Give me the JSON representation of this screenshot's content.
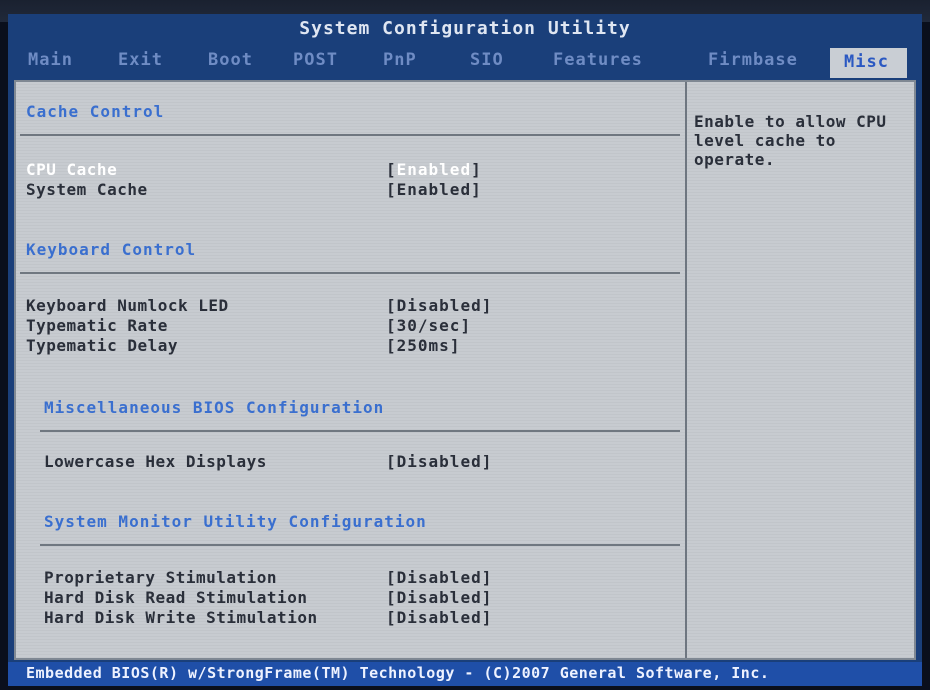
{
  "title": "System Configuration Utility",
  "tabs": [
    "Main",
    "Exit",
    "Boot",
    "POST",
    "PnP",
    "SIO",
    "Features",
    "Firmbase",
    "Misc"
  ],
  "active_tab": "Misc",
  "sections": {
    "cache": {
      "title": "Cache Control",
      "rows": [
        {
          "label": "CPU Cache",
          "value": "Enabled"
        },
        {
          "label": "System Cache",
          "value": "Enabled"
        }
      ]
    },
    "keyboard": {
      "title": "Keyboard Control",
      "rows": [
        {
          "label": "Keyboard Numlock LED",
          "value": "Disabled"
        },
        {
          "label": "Typematic Rate",
          "value": "30/sec"
        },
        {
          "label": "Typematic Delay",
          "value": "250ms"
        }
      ]
    },
    "misc_bios": {
      "title": "Miscellaneous BIOS Configuration",
      "rows": [
        {
          "label": "Lowercase Hex Displays",
          "value": "Disabled"
        }
      ]
    },
    "monitor": {
      "title": "System Monitor Utility Configuration",
      "rows": [
        {
          "label": "Proprietary Stimulation",
          "value": "Disabled"
        },
        {
          "label": "Hard Disk Read Stimulation",
          "value": "Disabled"
        },
        {
          "label": "Hard Disk Write Stimulation",
          "value": "Disabled"
        }
      ]
    }
  },
  "help_text": "Enable to allow CPU level cache to operate.",
  "status_bar": "Embedded BIOS(R) w/StrongFrame(TM) Technology - (C)2007 General Software, Inc.",
  "colors": {
    "screen_bg": "#1a3f7a",
    "panel_bg": "#c7cbd0",
    "section_title": "#3a6fcf",
    "selected_text": "#ffffff",
    "status_bar_bg": "#1f4fa8"
  }
}
